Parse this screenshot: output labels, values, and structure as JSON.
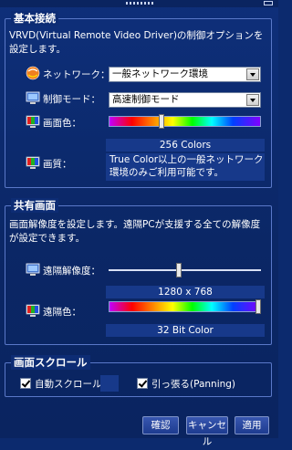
{
  "basic": {
    "title": "基本接続",
    "desc": "VRVD(Virtual Remote Video Driver)の制御オプションを設定します。",
    "network_label": "ネットワーク：",
    "network_value": "一般ネットワーク環境",
    "control_mode_label": "制御モード：",
    "control_mode_value": "高速制御モード",
    "screen_color_label": "画面色：",
    "screen_color_value": "256 Colors",
    "quality_label": "画質：",
    "quality_note": "True Color以上の一般ネットワーク環境のみご利用可能です。",
    "screen_color_level": 0.34
  },
  "shared": {
    "title": "共有画面",
    "desc": "画面解像度を設定します。遠隔PCが支援する全ての解像度が設定できます。",
    "resolution_label": "遠隔解像度：",
    "resolution_value": "1280 x 768",
    "color_label": "遠隔色：",
    "color_value": "32 Bit Color",
    "resolution_level": 0.46,
    "color_level": 1.0
  },
  "scroll": {
    "title": "画面スクロール",
    "auto_scroll_label": "自動スクロール",
    "auto_scroll_checked": true,
    "panning_label": "引っ張る(Panning)",
    "panning_checked": true
  },
  "buttons": {
    "ok": "確認",
    "cancel": "キャンセル",
    "apply": "適用"
  },
  "colors": {
    "background": "#0c2a6e",
    "border": "#5a78c8",
    "panel": "#17398a"
  }
}
